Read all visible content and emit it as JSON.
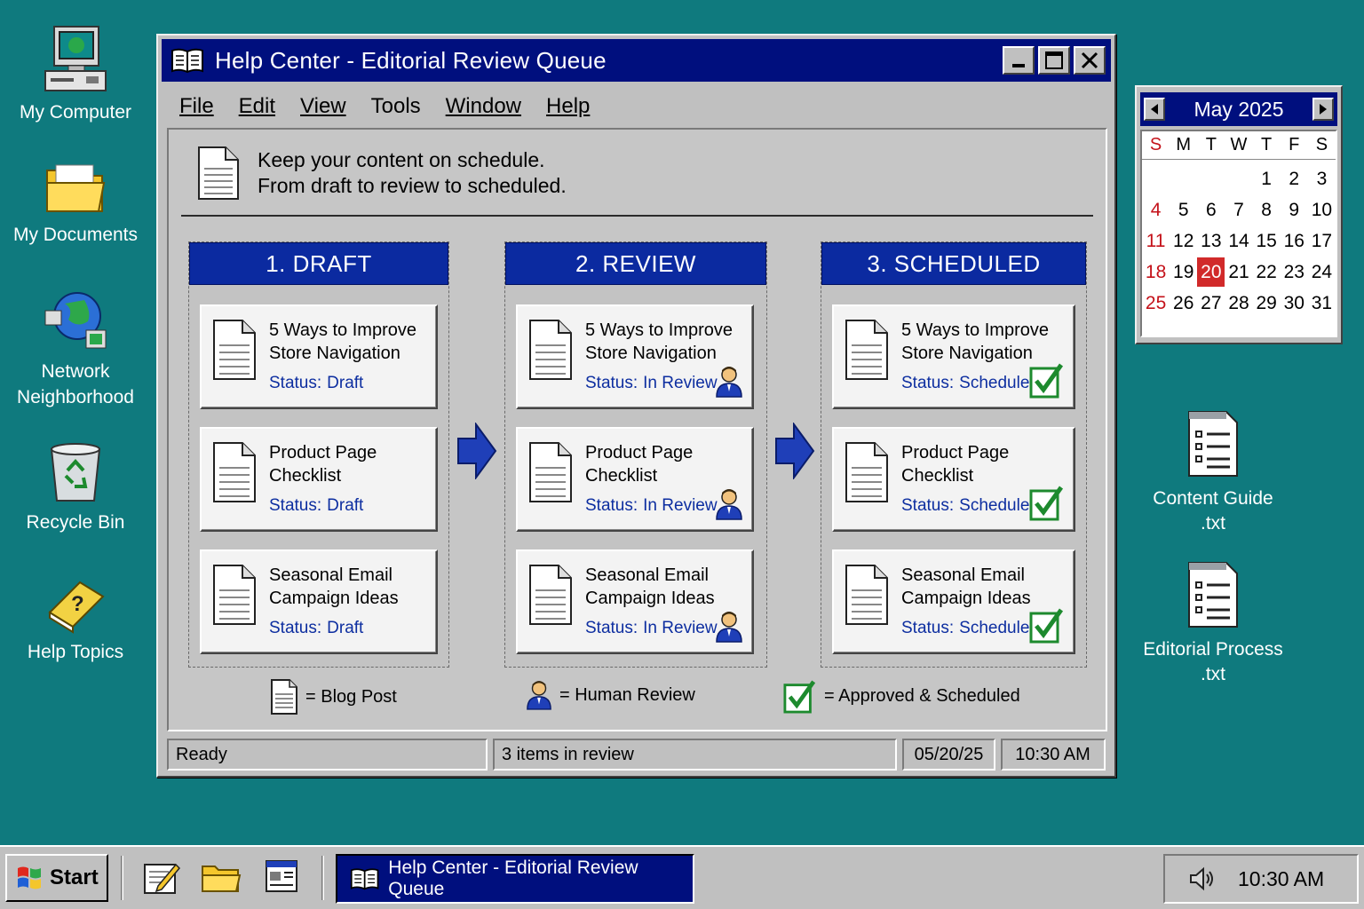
{
  "desktop": {
    "icons": [
      {
        "label": "My Computer",
        "icon": "computer-icon"
      },
      {
        "label": "My Documents",
        "icon": "folder-icon"
      },
      {
        "label": "Network Neighborhood",
        "icon": "network-icon"
      },
      {
        "label": "Recycle Bin",
        "icon": "recycle-bin-icon"
      },
      {
        "label": "Help Topics",
        "icon": "help-book-icon"
      }
    ],
    "files": [
      {
        "name": "Content Guide",
        "ext": ".txt"
      },
      {
        "name": "Editorial Process",
        "ext": ".txt"
      }
    ]
  },
  "window": {
    "title": "Help Center - Editorial Review Queue",
    "menu": [
      "File",
      "Edit",
      "View",
      "Tools",
      "Window",
      "Help"
    ],
    "intro_line1": "Keep your content on schedule.",
    "intro_line2": "From draft to review to scheduled.",
    "columns": [
      {
        "heading": "1. DRAFT",
        "cards": [
          {
            "title": "5 Ways to Improve Store Navigation",
            "status_label": "Status:",
            "status": "Draft",
            "badge": "none"
          },
          {
            "title": "Product Page Checklist",
            "status_label": "Status:",
            "status": "Draft",
            "badge": "none"
          },
          {
            "title": "Seasonal Email Campaign Ideas",
            "status_label": "Status:",
            "status": "Draft",
            "badge": "none"
          }
        ]
      },
      {
        "heading": "2. REVIEW",
        "cards": [
          {
            "title": "5 Ways to Improve Store Navigation",
            "status_label": "Status:",
            "status": "In Review",
            "badge": "human-review-icon"
          },
          {
            "title": "Product Page Checklist",
            "status_label": "Status:",
            "status": "In Review",
            "badge": "human-review-icon"
          },
          {
            "title": "Seasonal Email Campaign Ideas",
            "status_label": "Status:",
            "status": "In Review",
            "badge": "human-review-icon"
          }
        ]
      },
      {
        "heading": "3. SCHEDULED",
        "cards": [
          {
            "title": "5 Ways to Improve Store Navigation",
            "status_label": "Status:",
            "status": "Scheduled",
            "badge": "checkmark-icon"
          },
          {
            "title": "Product Page Checklist",
            "status_label": "Status:",
            "status": "Scheduled",
            "badge": "checkmark-icon"
          },
          {
            "title": "Seasonal Email Campaign Ideas",
            "status_label": "Status:",
            "status": "Scheduled",
            "badge": "checkmark-icon"
          }
        ]
      }
    ],
    "legend": [
      {
        "icon": "blog-post-icon",
        "label": "= Blog Post"
      },
      {
        "icon": "human-review-icon",
        "label": "= Human Review"
      },
      {
        "icon": "checkmark-icon",
        "label": "= Approved & Scheduled"
      }
    ],
    "statusbar": {
      "state": "Ready",
      "info": "3 items in review",
      "date": "05/20/25",
      "time": "10:30 AM"
    }
  },
  "calendar": {
    "month": "May 2025",
    "dow": [
      "S",
      "M",
      "T",
      "W",
      "T",
      "F",
      "S"
    ],
    "weeks": [
      [
        "",
        "",
        "",
        "",
        "1",
        "2",
        "3"
      ],
      [
        "4",
        "5",
        "6",
        "7",
        "8",
        "9",
        "10"
      ],
      [
        "11",
        "12",
        "13",
        "14",
        "15",
        "16",
        "17"
      ],
      [
        "18",
        "19",
        "20",
        "21",
        "22",
        "23",
        "24"
      ],
      [
        "25",
        "26",
        "27",
        "28",
        "29",
        "30",
        "31"
      ]
    ],
    "today": "20"
  },
  "taskbar": {
    "start_label": "Start",
    "task_title": "Help Center - Editorial Review Queue",
    "clock": "10:30 AM"
  },
  "colors": {
    "desktop": "#0f7a7e",
    "titlebar": "#000f7e",
    "column_header": "#0b2aa0",
    "status_text": "#0d2ea0",
    "check": "#1d8a2e",
    "today": "#d12a2a"
  }
}
